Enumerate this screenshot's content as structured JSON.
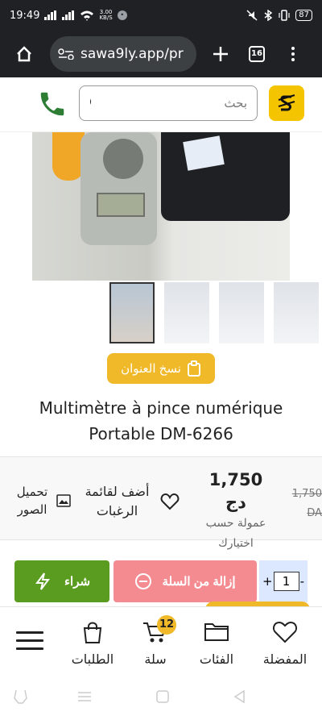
{
  "status_bar": {
    "time": "19:49",
    "speed_value": "3.00",
    "speed_unit": "KB/S",
    "battery": "87"
  },
  "browser": {
    "url": "sawa9ly.app/pr",
    "tabs_count": "16"
  },
  "header": {
    "search_placeholder": "بحث",
    "accent_color": "#f5c400",
    "phone_color": "#2d7d35"
  },
  "product": {
    "copy_title_label": "نسخ العنوان",
    "title_line_1": "Multimètre à pince numérique",
    "title_line_2": "Portable DM-6266",
    "price": "1,750 دج",
    "price_note": "عمولة حسب اختيارك",
    "old_price": "1,750 DA",
    "wishlist_label": "أضف لقائمة الرغبات",
    "upload_label": "تحميل الصور"
  },
  "cart_actions": {
    "buy_label": "شراء",
    "remove_label": "إزالة من السلة",
    "quantity": "1",
    "minus": "-",
    "plus": "+",
    "buy_color": "#5a9c1f",
    "remove_color": "#f48b91"
  },
  "bottom_nav": {
    "orders_label": "الطلبات",
    "cart_label": "سلة",
    "cart_count": "12",
    "categories_label": "الفئات",
    "favorites_label": "المفضلة"
  }
}
